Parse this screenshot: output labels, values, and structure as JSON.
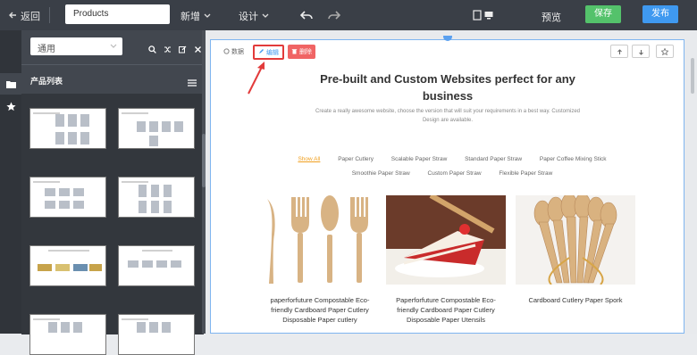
{
  "topbar": {
    "back_label": "返回",
    "page_value": "Products",
    "menu_new": "新增",
    "menu_design": "设计",
    "preview_label": "预览",
    "save_label": "保存",
    "publish_label": "发布"
  },
  "sidebar": {
    "select_value": "通用",
    "list_title": "产品列表"
  },
  "toolbar": {
    "data_label": "数据",
    "edit_label": "编辑",
    "delete_label": "删除"
  },
  "content": {
    "headline": "Pre-built and Custom Websites perfect for any business",
    "subtext": "Create a really awesome website, choose the version that will suit your requirements in a best way. Customized Design are available.",
    "filters": [
      "Show All",
      "Paper Cutlery",
      "Scalable Paper Straw",
      "Standard Paper Straw",
      "Paper Coffee Mixing Stick",
      "Smoothie Paper Straw",
      "Custom Paper Straw",
      "Flexible Paper Straw"
    ],
    "products": [
      {
        "name": "paperforfuture Compostable Eco-friendly Cardboard Paper Cutlery Disposable Paper cutlery"
      },
      {
        "name": "Paperforfuture Compostable Eco-friendly Cardboard Paper Cutlery Disposable Paper Utensils"
      },
      {
        "name": "Cardboard Cutlery Paper Spork"
      }
    ]
  },
  "colors": {
    "topbar": "#3a3f47",
    "save": "#54c26b",
    "publish": "#3f99f0",
    "delete": "#f06464",
    "highlight": "#e23b3b",
    "active_filter": "#f0a020"
  }
}
